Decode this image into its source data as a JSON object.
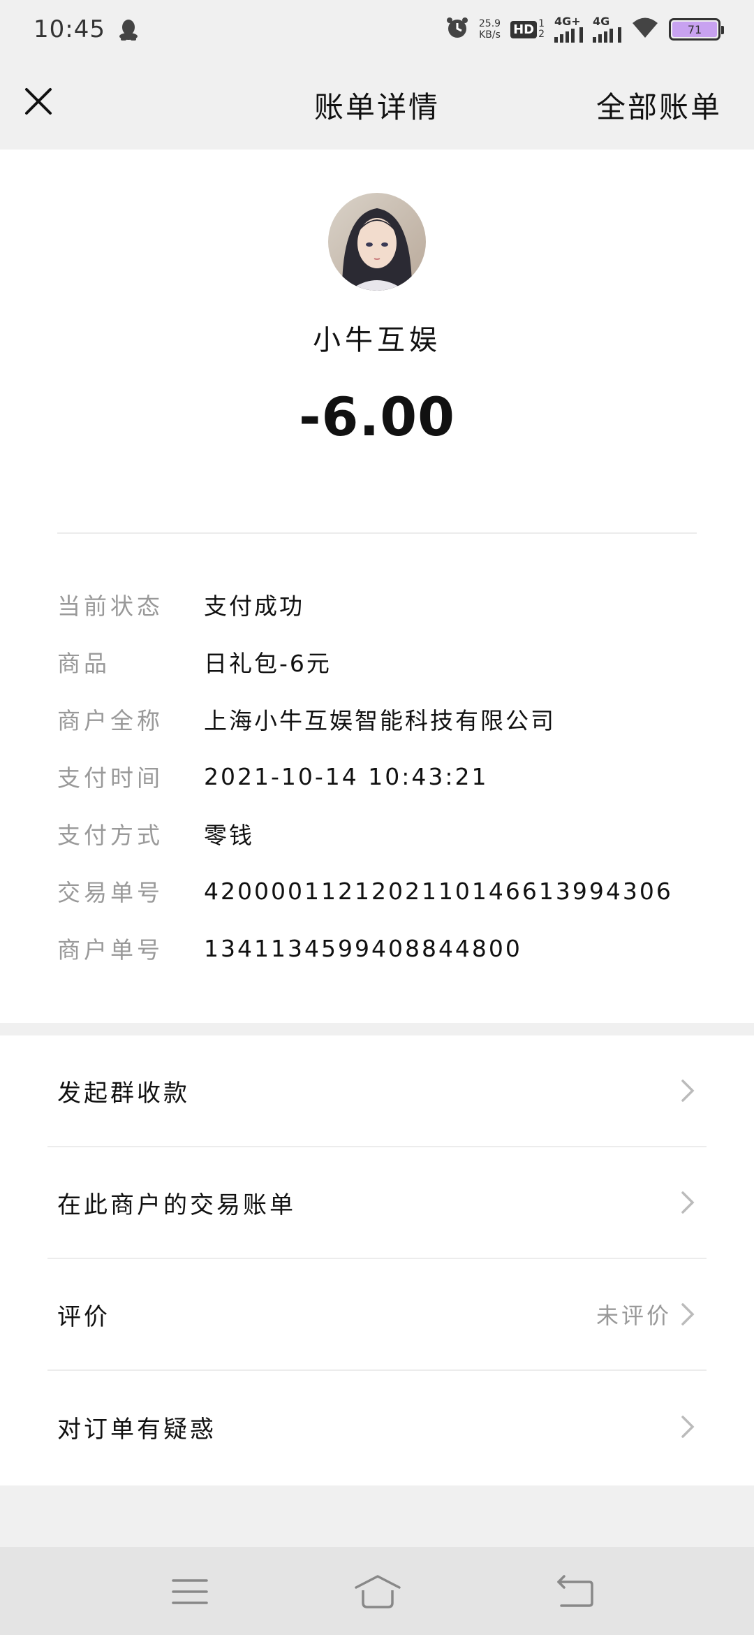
{
  "status_bar": {
    "time": "10:45",
    "speed_value": "25.9",
    "speed_unit": "KB/s",
    "hd_label": "HD",
    "hd_sub_top": "1",
    "hd_sub_bottom": "2",
    "net1": "4G+",
    "net2": "4G",
    "battery": "71",
    "icons": [
      "qq-icon",
      "alarm-icon",
      "wifi-icon",
      "battery-icon"
    ]
  },
  "header": {
    "title": "账单详情",
    "right_link": "全部账单"
  },
  "merchant": {
    "name": "小牛互娱",
    "amount": "-6.00"
  },
  "details": [
    {
      "label": "当前状态",
      "value": "支付成功"
    },
    {
      "label": "商品",
      "value": "日礼包-6元"
    },
    {
      "label": "商户全称",
      "value": "上海小牛互娱智能科技有限公司"
    },
    {
      "label": "支付时间",
      "value": "2021-10-14 10:43:21"
    },
    {
      "label": "支付方式",
      "value": "零钱"
    },
    {
      "label": "交易单号",
      "value": "4200001121202110146613994306"
    },
    {
      "label": "商户单号",
      "value": "1341134599408844800"
    }
  ],
  "actions": [
    {
      "label": "发起群收款",
      "sub": ""
    },
    {
      "label": "在此商户的交易账单",
      "sub": ""
    },
    {
      "label": "评价",
      "sub": "未评价"
    },
    {
      "label": "对订单有疑惑",
      "sub": ""
    }
  ],
  "colors": {
    "background": "#f0f0f0",
    "card": "#ffffff",
    "label_gray": "#999999",
    "battery_fill": "#c8a2f0"
  }
}
